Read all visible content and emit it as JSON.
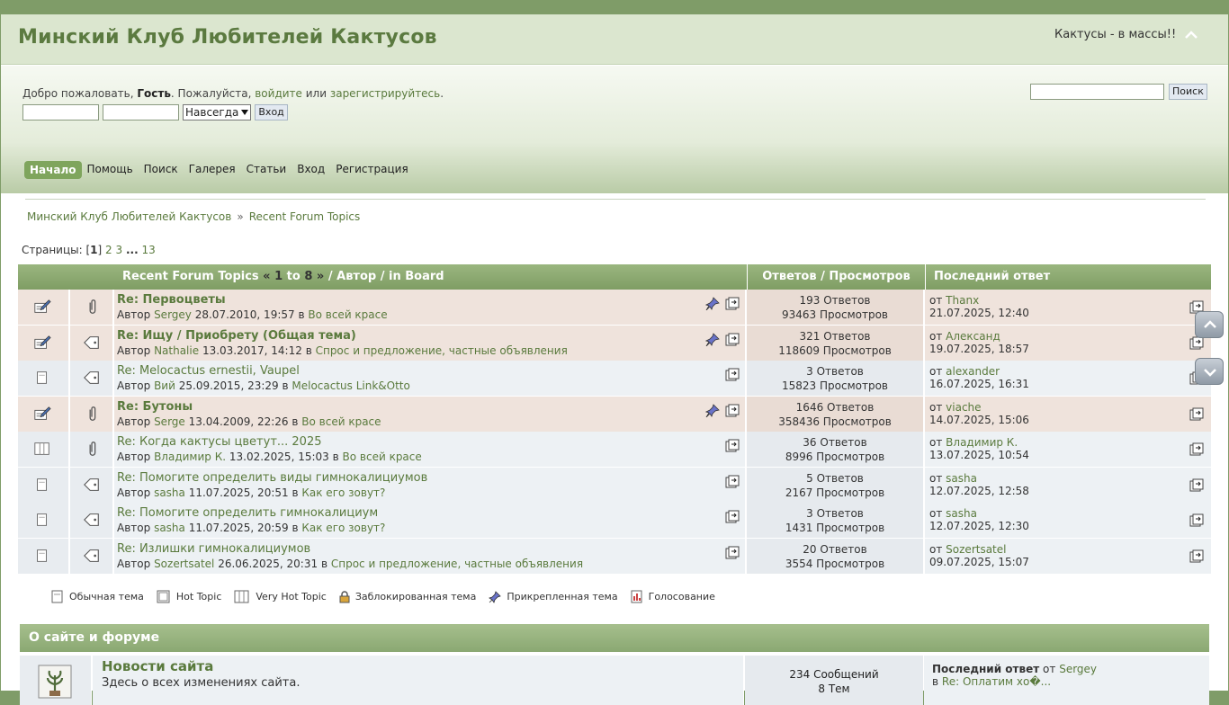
{
  "header": {
    "site_title": "Минский Клуб Любителей Кактусов",
    "slogan": "Кактусы - в массы!!",
    "collapse_icon": "chevron-up-icon"
  },
  "user_bar": {
    "welcome_prefix": "Добро пожаловать, ",
    "guest": "Гость",
    "welcome_mid": ". Пожалуйста, ",
    "login_link": "войдите",
    "or": " или ",
    "register_link": "зарегистрируйтесь",
    "end": ".",
    "session_select": "Навсегда",
    "login_button": "Вход",
    "search_button": "Поиск"
  },
  "menu": [
    "Начало",
    "Помощь",
    "Поиск",
    "Галерея",
    "Статьи",
    "Вход",
    "Регистрация"
  ],
  "breadcrumb": {
    "home": "Минский Клуб Любителей Кактусов",
    "separator": "»",
    "current": "Recent Forum Topics"
  },
  "pagination": {
    "label": "Страницы: ",
    "current": "1",
    "pages": [
      "2",
      "3"
    ],
    "ellipsis": "...",
    "last": "13"
  },
  "topics_table": {
    "header": {
      "title": "Recent Forum Topics",
      "range_open": " « ",
      "range_from": "1",
      "range_to": " to ",
      "range_end": "8",
      "range_close": " »",
      "suffix": " / Автор / in Board",
      "stats": "Ответов / Просмотров",
      "last": "Последний ответ"
    },
    "author_label": "Автор",
    "in_label": "в",
    "from_label": "от",
    "rows": [
      {
        "sticky": true,
        "type_icon": "hot-topic-icon",
        "msg_icon": "paperclip-icon",
        "title": "Re: Первоцветы",
        "author": "Sergey",
        "date": "28.07.2010, 19:57",
        "board": "Во всей красе",
        "replies": "193 Ответов",
        "views": "93463 Просмотров",
        "last_by": "Thanx",
        "last_date": "21.07.2025, 12:40"
      },
      {
        "sticky": true,
        "type_icon": "hot-topic-icon",
        "msg_icon": "tag-icon",
        "title": "Re: Ищу / Приобрету (Общая тема)",
        "author": "Nathalie",
        "date": "13.03.2017, 14:12",
        "board": "Спрос и предложение, частные объявления",
        "replies": "321 Ответов",
        "views": "118609 Просмотров",
        "last_by": "Александ",
        "last_date": "19.07.2025, 18:57"
      },
      {
        "sticky": false,
        "type_icon": "normal-topic-icon",
        "msg_icon": "tag-icon",
        "title": "Re: Melocactus ernestii, Vaupel",
        "author": "Вий",
        "date": "25.09.2015, 23:29",
        "board": "Melocactus Link&Otto",
        "replies": "3 Ответов",
        "views": "15823 Просмотров",
        "last_by": "alexander",
        "last_date": "16.07.2025, 16:31"
      },
      {
        "sticky": true,
        "type_icon": "hot-topic-icon",
        "msg_icon": "paperclip-icon",
        "title": "Re: Бутоны",
        "author": "Serge",
        "date": "13.04.2009, 22:26",
        "board": "Во всей красе",
        "replies": "1646 Ответов",
        "views": "358436 Просмотров",
        "last_by": "viache",
        "last_date": "14.07.2025, 15:06"
      },
      {
        "sticky": false,
        "type_icon": "very-hot-topic-icon",
        "msg_icon": "paperclip-icon",
        "title": "Re: Когда кактусы цветут... 2025",
        "author": "Владимир К.",
        "date": "13.02.2025, 15:03",
        "board": "Во всей красе",
        "replies": "36 Ответов",
        "views": "8996 Просмотров",
        "last_by": "Владимир К.",
        "last_date": "13.07.2025, 10:54"
      },
      {
        "sticky": false,
        "type_icon": "normal-topic-icon",
        "msg_icon": "tag-icon",
        "title": "Re: Помогите определить виды гимнокалициумов",
        "author": "sasha",
        "date": "11.07.2025, 20:51",
        "board": "Как его зовут?",
        "replies": "5 Ответов",
        "views": "2167 Просмотров",
        "last_by": "sasha",
        "last_date": "12.07.2025, 12:58"
      },
      {
        "sticky": false,
        "type_icon": "normal-topic-icon",
        "msg_icon": "tag-icon",
        "title": "Re: Помогите определить гимнокалициум",
        "author": "sasha",
        "date": "11.07.2025, 20:59",
        "board": "Как его зовут?",
        "replies": "3 Ответов",
        "views": "1431 Просмотров",
        "last_by": "sasha",
        "last_date": "12.07.2025, 12:30"
      },
      {
        "sticky": false,
        "type_icon": "normal-topic-icon",
        "msg_icon": "tag-icon",
        "title": "Re: Излишки гимнокалициумов",
        "author": "Sozertsatel",
        "date": "26.06.2025, 20:31",
        "board": "Спрос и предложение, частные объявления",
        "replies": "20 Ответов",
        "views": "3554 Просмотров",
        "last_by": "Sozertsatel",
        "last_date": "09.07.2025, 15:07"
      }
    ]
  },
  "legend": [
    {
      "icon": "normal-topic-icon",
      "label": "Обычная тема"
    },
    {
      "icon": "hot-topic-icon",
      "label": "Hot Topic"
    },
    {
      "icon": "very-hot-topic-icon",
      "label": "Very Hot Topic"
    },
    {
      "icon": "lock-icon",
      "label": "Заблокированная тема"
    },
    {
      "icon": "pin-icon",
      "label": "Прикрепленная тема"
    },
    {
      "icon": "poll-icon",
      "label": "Голосование"
    }
  ],
  "board_section": {
    "title": "О сайте и форуме",
    "board": {
      "name": "Новости сайта",
      "description": "Здесь о всех изменениях сайта.",
      "posts": "234 Сообщений",
      "topics": "8 Тем",
      "last_label": "Последний ответ",
      "from_label": "от",
      "last_by": "Sergey",
      "in_label": "в",
      "last_topic": "Re: Оплатим хо�..."
    }
  },
  "scroll_buttons": [
    "scroll-up-icon",
    "scroll-down-icon"
  ],
  "colors": {
    "accent": "#7f9c68",
    "link": "#5a7a3d",
    "sticky_row": "#efe3dc",
    "row": "#edf1f4"
  }
}
